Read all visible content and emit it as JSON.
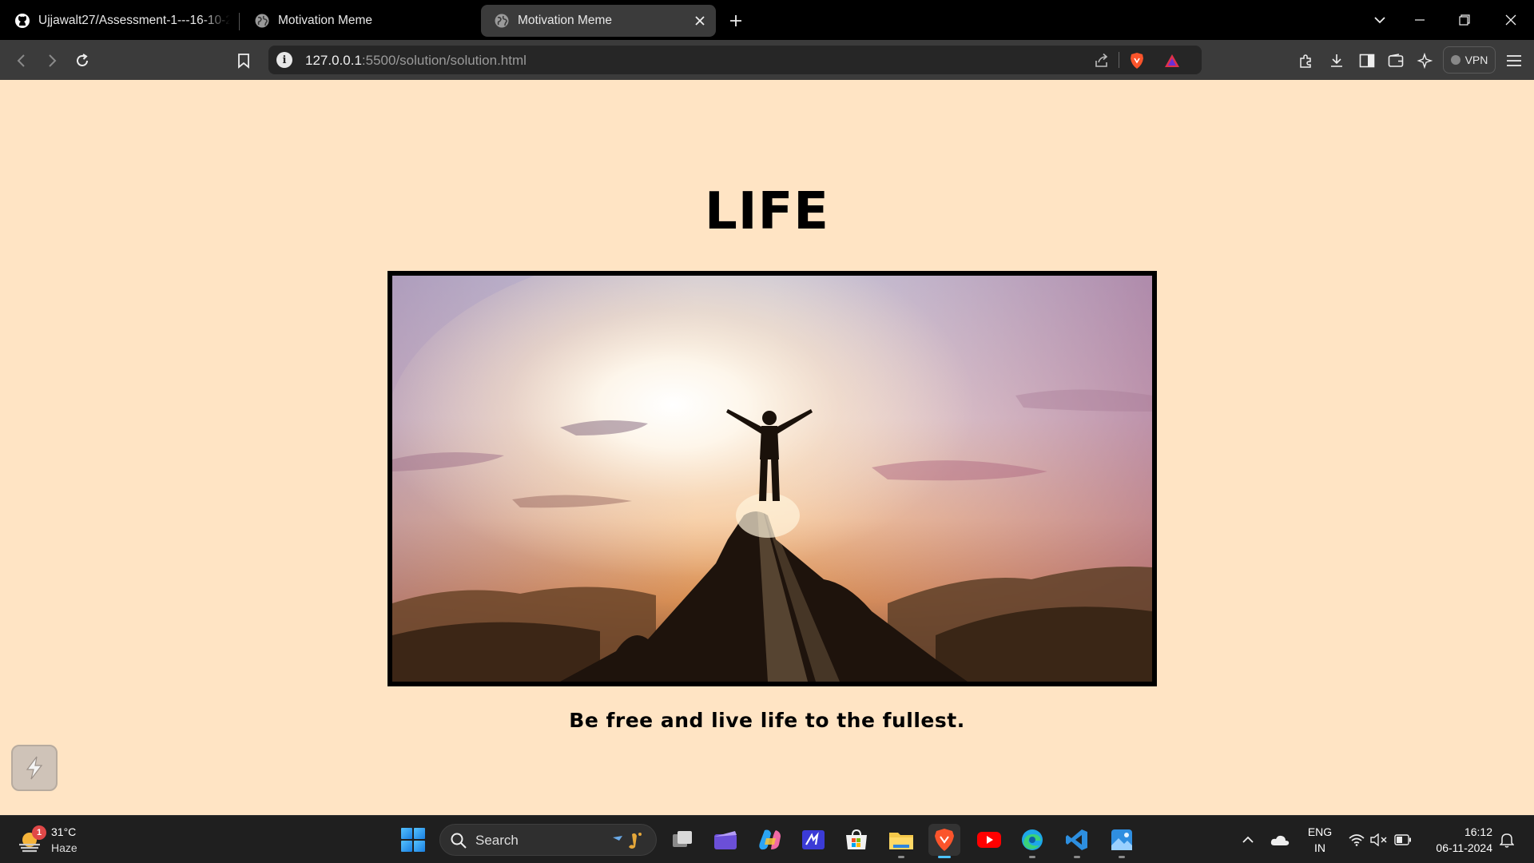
{
  "browser": {
    "tabs": [
      {
        "title": "Ujjawalt27/Assessment-1---16-10-2",
        "icon": "github-icon"
      },
      {
        "title": "Motivation Meme",
        "icon": "globe-icon"
      },
      {
        "title": "Motivation Meme",
        "icon": "globe-icon",
        "active": true
      }
    ],
    "address": {
      "host": "127.0.0.1",
      "path": ":5500/solution/solution.html"
    },
    "vpn_label": "VPN"
  },
  "page": {
    "heading": "LIFE",
    "image_description_icon": "mountain-sunrise-photo",
    "caption": "Be free and live life to the fullest.",
    "background_color": "#ffe4c4"
  },
  "taskbar": {
    "weather": {
      "temp": "31°C",
      "condition": "Haze",
      "badge": "1"
    },
    "search_placeholder": "Search",
    "language": {
      "line1": "ENG",
      "line2": "IN"
    },
    "clock": {
      "time": "16:12",
      "date": "06-11-2024"
    }
  }
}
